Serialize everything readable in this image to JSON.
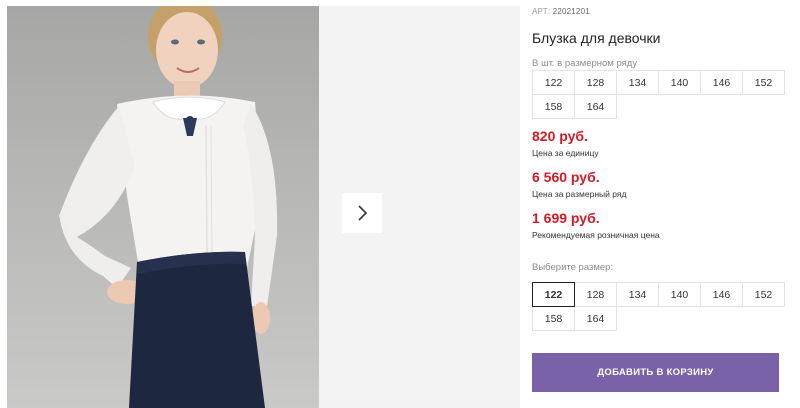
{
  "product": {
    "sku_label": "АРТ:",
    "sku": "22021201",
    "title": "Блузка для девочки",
    "image_alt_icon": "product-photo"
  },
  "set_sizes": {
    "label": "В шт. в размерном ряду",
    "items": [
      "122",
      "128",
      "134",
      "140",
      "146",
      "152",
      "158",
      "164"
    ]
  },
  "prices": {
    "unit_price": "820 руб.",
    "unit_caption": "Цена за единицу",
    "set_price": "6 560 руб.",
    "set_caption": "Цена за размерный ряд",
    "retail_price": "1 699 руб.",
    "retail_caption": "Рекомендуемая розничная цена"
  },
  "size_select": {
    "label": "Выберите размер:",
    "selected": "122",
    "options": [
      "122",
      "128",
      "134",
      "140",
      "146",
      "152",
      "158",
      "164"
    ]
  },
  "actions": {
    "add_to_cart": "ДОБАВИТЬ В КОРЗИНУ"
  },
  "colors": {
    "price_red": "#d41a26",
    "cart_button": "#7a62a8",
    "photo_bg": "#b5b5b4",
    "blouse": "#f4f3f1",
    "skirt": "#1e2740"
  },
  "icons": {
    "gallery_next": "chevron-right-icon"
  }
}
